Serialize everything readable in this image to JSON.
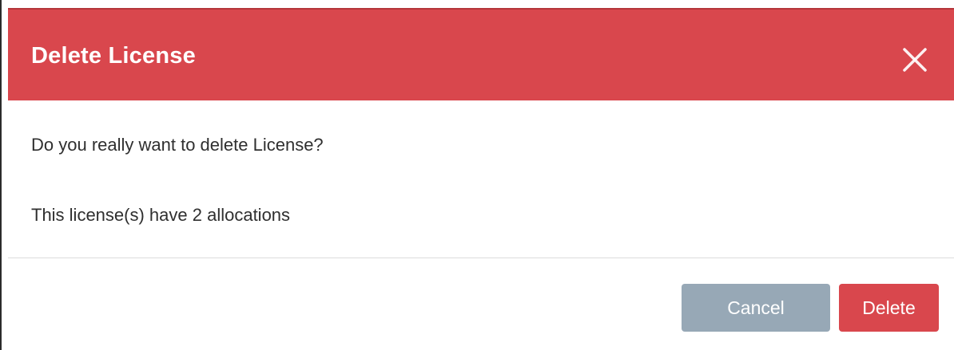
{
  "dialog": {
    "title": "Delete License",
    "close_icon": "close-icon",
    "message": "Do you really want to delete License?",
    "allocation_note": "This license(s) have 2 allocations",
    "buttons": {
      "cancel_label": "Cancel",
      "delete_label": "Delete"
    }
  },
  "colors": {
    "header_background": "#d9474d",
    "cancel_button": "#97a8b6",
    "delete_button": "#d9474d"
  }
}
